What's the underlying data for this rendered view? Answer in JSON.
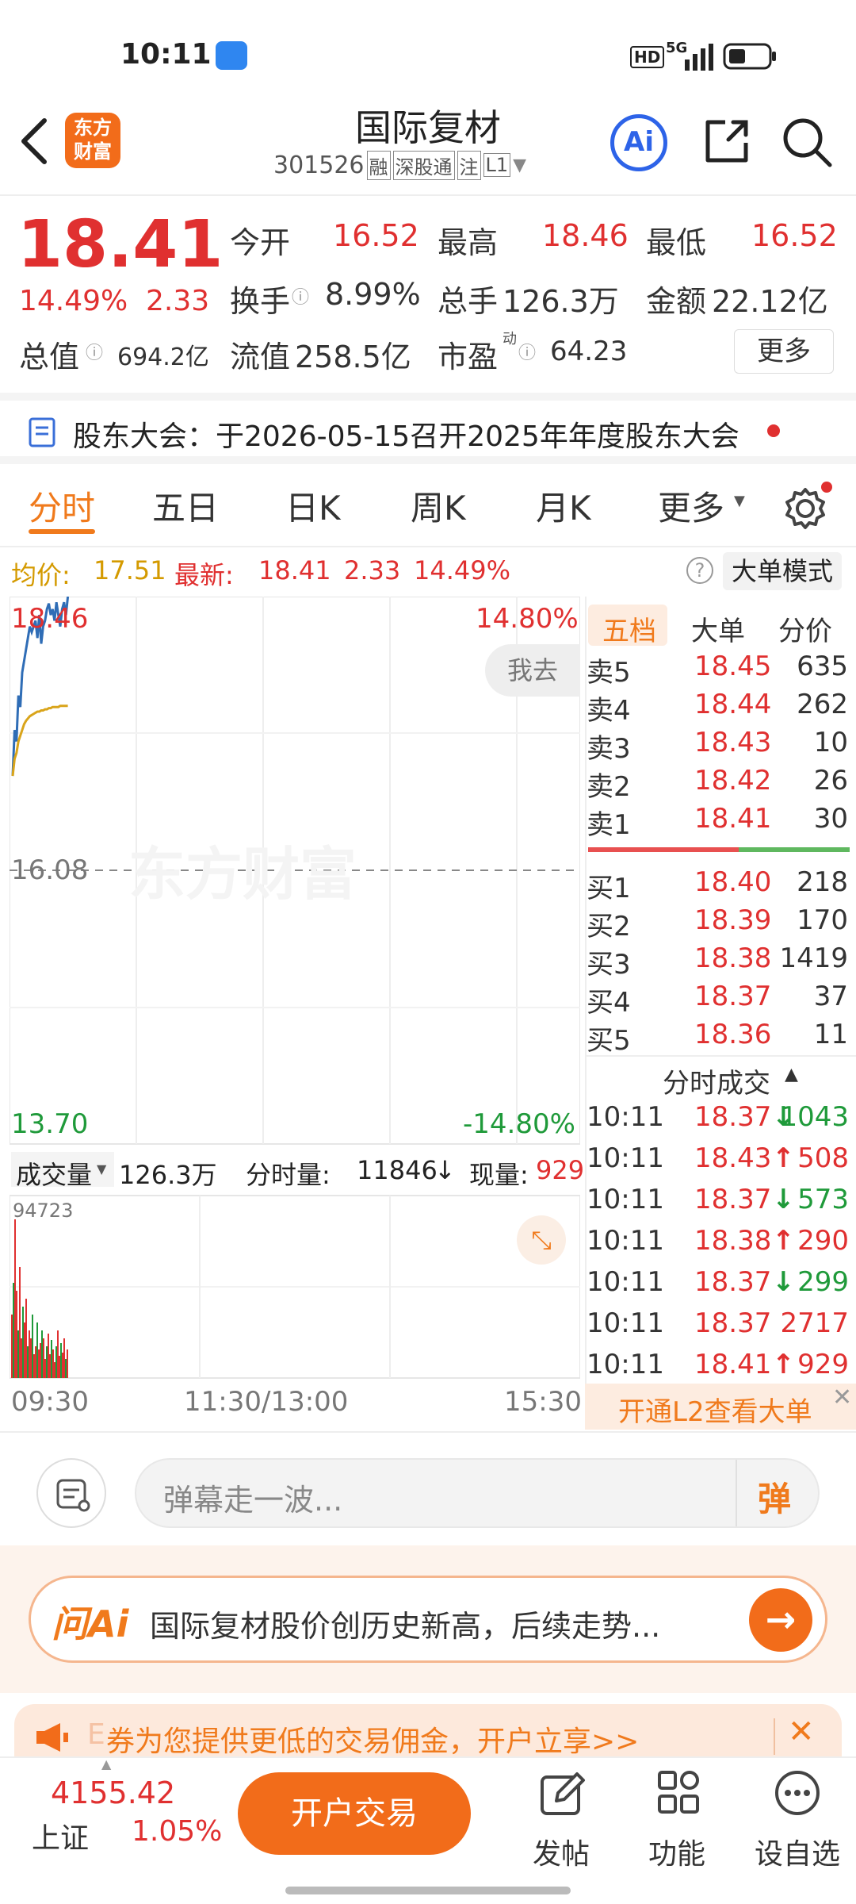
{
  "status_bar": {
    "time": "10:11",
    "hd": "HD",
    "net": "5G"
  },
  "header": {
    "logo_text": "东方财富",
    "title": "国际复材",
    "code": "301526",
    "tags": [
      "融",
      "深股通",
      "注",
      "L1"
    ],
    "ai_label": "Ai"
  },
  "quote": {
    "price": "18.41",
    "pct": "14.49%",
    "change": "2.33",
    "open_label": "今开",
    "open": "16.52",
    "high_label": "最高",
    "high": "18.46",
    "low_label": "最低",
    "low": "16.52",
    "turnover_label": "换手",
    "turnover": "8.99%",
    "volume_label": "总手",
    "volume": "126.3万",
    "amount_label": "金额",
    "amount": "22.12亿",
    "mcap_label": "总值",
    "mcap": "694.2亿",
    "float_label": "流值",
    "float": "258.5亿",
    "pe_label": "市盈",
    "pe_sup": "动",
    "pe": "64.23",
    "more": "更多"
  },
  "notice": {
    "text": "股东大会：于2026-05-15召开2025年年度股东大会"
  },
  "tabs": {
    "items": [
      "分时",
      "五日",
      "日K",
      "周K",
      "月K",
      "更多"
    ],
    "active": "分时"
  },
  "info_line": {
    "avg_label": "均价:",
    "avg": "17.51",
    "latest_label": "最新:",
    "latest": "18.41",
    "chg": "2.33",
    "pct": "14.49%",
    "mode": "大单模式"
  },
  "chart": {
    "y_top": "18.46",
    "y_mid": "16.08",
    "y_bottom": "13.70",
    "pct_top": "14.80%",
    "pct_bottom": "-14.80%",
    "go_btn": "我去",
    "watermark": "东方财富",
    "vol_label": "成交量",
    "vol_total": "126.3万",
    "vol_min_label": "分时量:",
    "vol_min": "11846",
    "vol_now_label": "现量:",
    "vol_now": "929",
    "vol_max": "94723",
    "x_labels": [
      "09:30",
      "11:30/13:00",
      "15:30"
    ]
  },
  "chart_data": {
    "type": "line",
    "title": "",
    "ylim": [
      13.7,
      18.46
    ],
    "series": [
      {
        "values": [
          16.9,
          17.3,
          17.2,
          17.6,
          17.5,
          17.8,
          17.9,
          18.0,
          18.1,
          18.2,
          18.15,
          18.2,
          18.25,
          18.1,
          18.3,
          18.05,
          18.2,
          18.25,
          18.35,
          18.4,
          18.3,
          18.35,
          18.25,
          18.41,
          18.3,
          18.2,
          18.35,
          18.41,
          18.3,
          18.46
        ]
      },
      {
        "values": [
          16.9,
          17.05,
          17.1,
          17.2,
          17.25,
          17.3,
          17.35,
          17.38,
          17.4,
          17.42,
          17.43,
          17.44,
          17.45,
          17.46,
          17.46,
          17.47,
          17.47,
          17.48,
          17.48,
          17.49,
          17.49,
          17.5,
          17.5,
          17.5,
          17.5,
          17.51,
          17.51,
          17.51,
          17.51,
          17.51
        ]
      }
    ],
    "volume": [
      40,
      60,
      94723,
      55,
      30,
      70,
      25,
      45,
      35,
      50,
      20,
      30,
      25,
      40,
      15,
      20,
      35,
      18,
      22,
      30,
      25,
      12,
      20,
      28,
      15,
      24,
      18,
      10,
      20,
      30,
      14,
      22,
      16,
      25,
      12,
      18
    ]
  },
  "order_book": {
    "tabs": [
      "五档",
      "大单",
      "分价"
    ],
    "asks": [
      {
        "label": "卖5",
        "price": "18.45",
        "vol": "635"
      },
      {
        "label": "卖4",
        "price": "18.44",
        "vol": "262"
      },
      {
        "label": "卖3",
        "price": "18.43",
        "vol": "10"
      },
      {
        "label": "卖2",
        "price": "18.42",
        "vol": "26"
      },
      {
        "label": "卖1",
        "price": "18.41",
        "vol": "30"
      }
    ],
    "bids": [
      {
        "label": "买1",
        "price": "18.40",
        "vol": "218"
      },
      {
        "label": "买2",
        "price": "18.39",
        "vol": "170"
      },
      {
        "label": "买3",
        "price": "18.38",
        "vol": "1419"
      },
      {
        "label": "买4",
        "price": "18.37",
        "vol": "37"
      },
      {
        "label": "买5",
        "price": "18.36",
        "vol": "11"
      }
    ],
    "trades_title": "分时成交",
    "trades": [
      {
        "time": "10:11",
        "price": "18.37",
        "dir": "down",
        "vol": "1043"
      },
      {
        "time": "10:11",
        "price": "18.43",
        "dir": "up",
        "vol": "508"
      },
      {
        "time": "10:11",
        "price": "18.37",
        "dir": "down",
        "vol": "573"
      },
      {
        "time": "10:11",
        "price": "18.38",
        "dir": "up",
        "vol": "290"
      },
      {
        "time": "10:11",
        "price": "18.37",
        "dir": "down",
        "vol": "299"
      },
      {
        "time": "10:11",
        "price": "18.37",
        "dir": "none",
        "vol": "2717"
      },
      {
        "time": "10:11",
        "price": "18.41",
        "dir": "up",
        "vol": "929"
      }
    ],
    "l2_banner": "开通L2查看大单"
  },
  "comment": {
    "placeholder": "弹幕走一波...",
    "btn": "弹"
  },
  "ai_banner": {
    "label": "问Ai",
    "text": "国际复材股价创历史新高，后续走势..."
  },
  "ad": {
    "text": "券为您提供更低的交易佣金，开户立享>>",
    "prefix": "E"
  },
  "bottom_nav": {
    "index_value": "4155.42",
    "index_name": "上证",
    "index_pct": "1.05%",
    "trade_btn": "开户交易",
    "items": [
      "发帖",
      "功能",
      "设自选"
    ]
  }
}
